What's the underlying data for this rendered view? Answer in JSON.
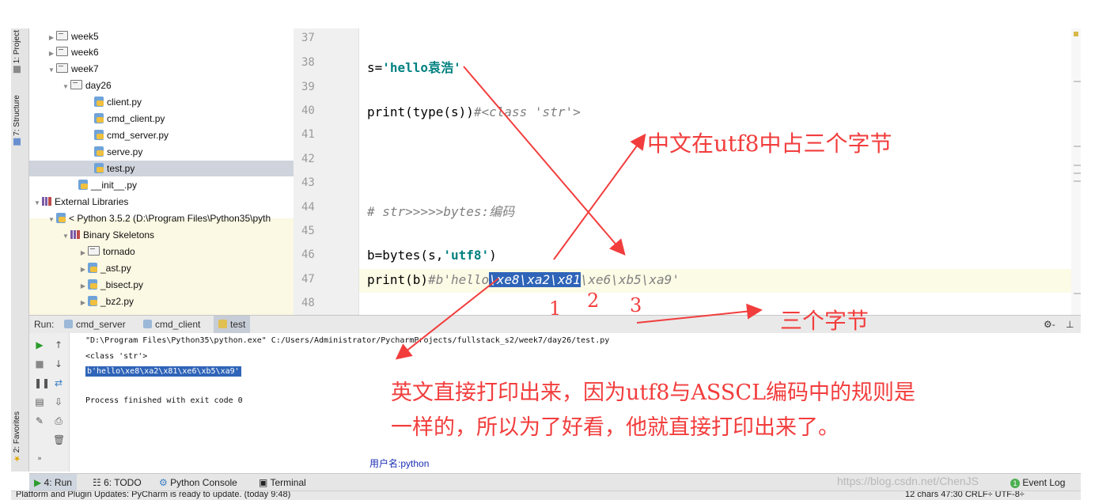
{
  "tool_windows": {
    "project": "1: Project",
    "structure": "7: Structure",
    "favorites": "2: Favorites"
  },
  "project_tree": {
    "items": [
      {
        "label": "week5",
        "kind": "folder",
        "arrow": "▶"
      },
      {
        "label": "week6",
        "kind": "folder",
        "arrow": "▶"
      },
      {
        "label": "week7",
        "kind": "folder",
        "arrow": "▼"
      },
      {
        "label": "day26",
        "kind": "folder",
        "arrow": "▼"
      },
      {
        "label": "client.py",
        "kind": "file"
      },
      {
        "label": "cmd_client.py",
        "kind": "file"
      },
      {
        "label": "cmd_server.py",
        "kind": "file"
      },
      {
        "label": "serve.py",
        "kind": "file"
      },
      {
        "label": "test.py",
        "kind": "file",
        "selected": true
      },
      {
        "label": "__init__.py",
        "kind": "file"
      },
      {
        "label": "External Libraries",
        "kind": "library",
        "arrow": "▼"
      },
      {
        "label": "< Python 3.5.2 (D:\\Program Files\\Python35\\pyth",
        "kind": "sdk",
        "arrow": "▼"
      },
      {
        "label": "Binary Skeletons",
        "kind": "library",
        "arrow": "▼"
      },
      {
        "label": "tornado",
        "kind": "folder",
        "arrow": "▶"
      },
      {
        "label": "_ast.py",
        "kind": "file",
        "arrow": "▶"
      },
      {
        "label": "_bisect.py",
        "kind": "file",
        "arrow": "▶"
      },
      {
        "label": "_bz2.py",
        "kind": "file",
        "arrow": "▶"
      }
    ]
  },
  "editor": {
    "line_numbers": [
      "37",
      "38",
      "39",
      "40",
      "41",
      "42",
      "43",
      "44",
      "45",
      "46",
      "47",
      "48"
    ],
    "line38": {
      "code": "s=",
      "str": "'hello袁浩'"
    },
    "line40": {
      "code": "print(type(s))",
      "comment": "#<class 'str'>"
    },
    "line44": {
      "comment": "# str>>>>>bytes:编码"
    },
    "line46": {
      "code": "b=bytes(s,",
      "str": "'utf8'",
      "close": ")"
    },
    "line47": {
      "code": "print(b)",
      "c1": "#b'hello",
      "c2": "\\xe8\\xa2\\x81",
      "c3": "\\xe6\\xb5\\xa9'"
    }
  },
  "run_panel": {
    "label": "Run:",
    "tabs": [
      "cmd_server",
      "cmd_client",
      "test"
    ],
    "console": {
      "cmd": "\"D:\\Program Files\\Python35\\python.exe\" C:/Users/Administrator/PycharmProjects/fullstack_s2/week7/day26/test.py",
      "out1": "<class 'str'>",
      "out2": "b'hello\\xe8\\xa2\\x81\\xe6\\xb5\\xa9'",
      "finish": "Process finished with exit code 0"
    },
    "gear": "⚙-",
    "pin": "⊥"
  },
  "username": "用户名:python",
  "bottom_tabs": [
    "4: Run",
    "6: TODO",
    "Python Console",
    "Terminal"
  ],
  "event_log": {
    "badge": "1",
    "label": "Event Log"
  },
  "status": {
    "message": "Platform and Plugin Updates: PyCharm is ready to update. (today 9:48)",
    "right": "12 chars     47:30   CRLF÷   UTF-8÷"
  },
  "annotations": {
    "utf8_note": "中文在utf8中占三个字节",
    "num1": "1",
    "num2": "2",
    "num3": "3",
    "three_bytes": "三个字节",
    "line1": "英文直接打印出来，因为utf8与ASSCL编码中的规则是",
    "line2": "一样的，所以为了好看，他就直接打印出来了。"
  },
  "watermark": "https://blog.csdn.net/ChenJS",
  "colors": {
    "annotation": "#f23d3d",
    "selection": "#2f64b8",
    "string": "#008080"
  }
}
